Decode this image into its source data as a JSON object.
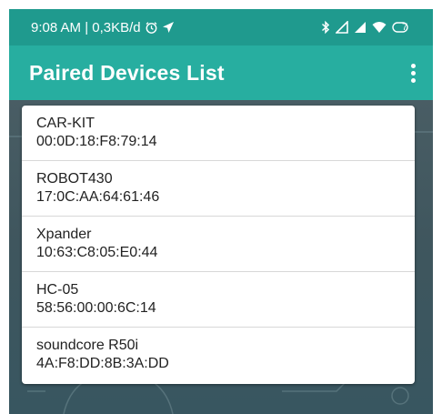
{
  "status_bar": {
    "time_and_speed": "9:08 AM | 0,3KB/d",
    "battery_level": "7",
    "icons": [
      "alarm-icon",
      "location-arrow-icon",
      "bluetooth-icon",
      "signal-icon",
      "wifi-icon",
      "battery-icon"
    ]
  },
  "app_bar": {
    "title": "Paired Devices List",
    "menu_icon": "more-vertical-icon"
  },
  "devices": [
    {
      "name": "CAR-KIT",
      "address": "00:0D:18:F8:79:14"
    },
    {
      "name": "ROBOT430",
      "address": "17:0C:AA:64:61:46"
    },
    {
      "name": "Xpander",
      "address": "10:63:C8:05:E0:44"
    },
    {
      "name": "HC-05",
      "address": "58:56:00:00:6C:14"
    },
    {
      "name": "soundcore R50i",
      "address": "4A:F8:DD:8B:3A:DD"
    }
  ],
  "colors": {
    "status_bar": "#1f9a8e",
    "app_bar": "#27aea0",
    "list_background": "#ffffff",
    "content_background": "#3f565e"
  }
}
